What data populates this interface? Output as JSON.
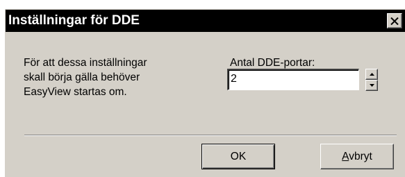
{
  "dialog": {
    "title": "Inställningar för DDE",
    "close_icon": "close-icon"
  },
  "info": {
    "lines": [
      "För att dessa inställningar",
      "skall börja gälla behöver",
      "EasyView startas om."
    ]
  },
  "ports": {
    "label": "Antal DDE-portar:",
    "value": "2",
    "up_icon": "spin-up-icon",
    "down_icon": "spin-down-icon"
  },
  "buttons": {
    "ok_label": "OK",
    "cancel_mnemonic": "A",
    "cancel_rest": "vbryt"
  },
  "colors": {
    "titlebar": "#000000",
    "face": "#d4d0c8"
  }
}
